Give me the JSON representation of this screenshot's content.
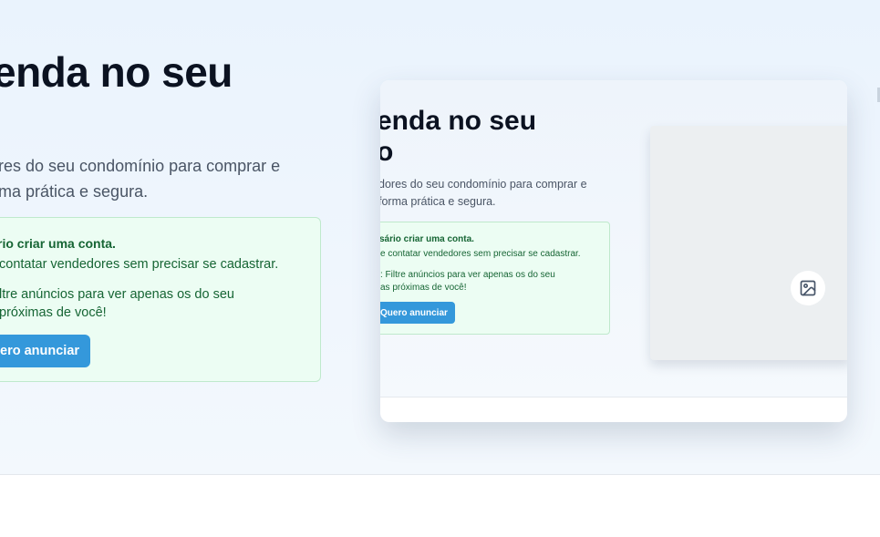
{
  "hero": {
    "title": "enda no seu",
    "description": "res do seu condomínio para comprar e\nma prática e segura.",
    "info_box": {
      "title": "rio criar uma conta.",
      "line": "contatar vendedores sem precisar se cadastrar.",
      "tip": "ltre anúncios para ver apenas os do seu\npróximas de você!"
    },
    "cta_label": "ero anunciar"
  },
  "preview": {
    "title": "enda no seu\no",
    "description": "dores do seu condomínio para comprar e\nforma prática e segura.",
    "info_box": {
      "title": "sário criar uma conta.",
      "line": "e contatar vendedores sem precisar se cadastrar.",
      "tip": ": Filtre anúncios para ver apenas os do seu\nas próximas de você!"
    },
    "cta_label": "Quero anunciar",
    "image_icon": "image-placeholder-icon"
  },
  "colors": {
    "accent": "#3498db",
    "success_bg": "#ecfdf3",
    "success_text": "#166534",
    "heading": "#0b1221"
  }
}
